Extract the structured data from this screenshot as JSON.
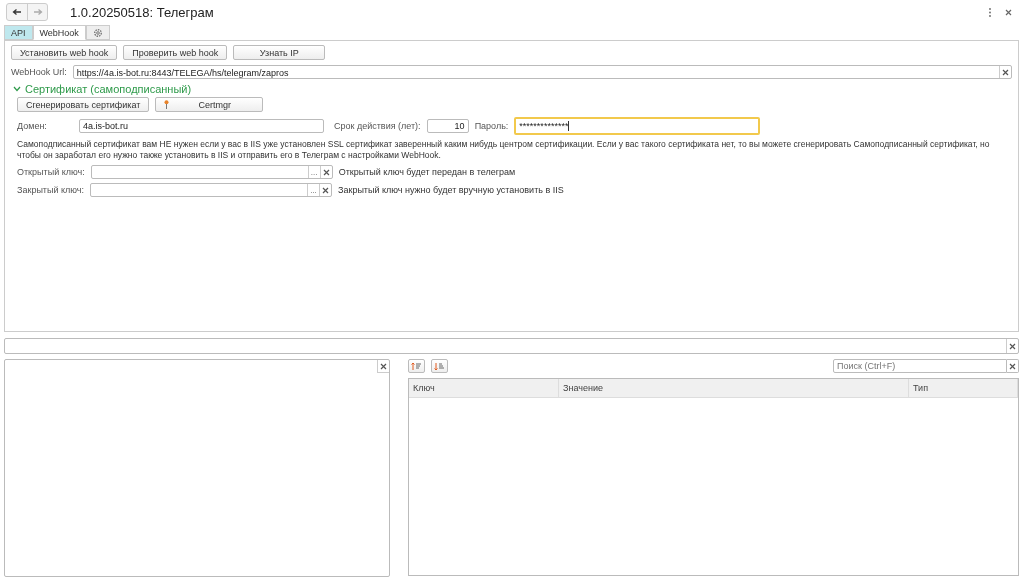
{
  "window": {
    "title": "1.0.20250518: Телеграм"
  },
  "nav": {
    "back_disabled": false,
    "forward_disabled": true
  },
  "tabs": [
    {
      "kind": "text",
      "label": "API",
      "selected": false,
      "highlighted": true
    },
    {
      "kind": "text",
      "label": "WebHook",
      "selected": true,
      "highlighted": false
    },
    {
      "kind": "gear",
      "selected": false,
      "highlighted": false
    }
  ],
  "buttons": [
    "Установить web hook",
    "Проверить web hook",
    "Узнать IP"
  ],
  "webhook_url": {
    "label": "WebHook Url:",
    "value": "https://4a.is-bot.ru:8443/TELEGA/hs/telegram/zapros"
  },
  "certificate": {
    "title": "Сертификат (самоподписанный)",
    "expanded": true,
    "buttons": [
      {
        "label": "Сгенерировать сертификат",
        "kind": "plain"
      },
      {
        "label": "Certmgr",
        "kind": "pin"
      }
    ],
    "domain": {
      "label": "Домен:",
      "value": "4a.is-bot.ru"
    },
    "validity": {
      "label": "Срок действия (лет):",
      "value": "10"
    },
    "password": {
      "label": "Пароль:",
      "value": "**************",
      "focused": true
    },
    "note": "Самоподписанный сертификат вам НЕ нужен если у вас в IIS уже установлен SSL сертификат заверенный каким нибудь центром сертификации. Если у вас такого сертификата нет, то вы можете сгенерировать Самоподписанный сертификат, но чтобы он заработал его нужно также установить в IIS и отправить его в Телеграм с настройками WebHook.",
    "keys": [
      {
        "label": "Открытый ключ:",
        "choose": "...",
        "hint": "Открытый ключ будет передан в телеграм"
      },
      {
        "label": "Закрытый ключ:",
        "choose": "...",
        "hint": "Закрытый ключ нужно будет вручную установить в IIS"
      }
    ]
  },
  "table": {
    "search_placeholder": "Поиск (Ctrl+F)",
    "columns": [
      "Ключ",
      "Значение",
      "Тип"
    ]
  }
}
